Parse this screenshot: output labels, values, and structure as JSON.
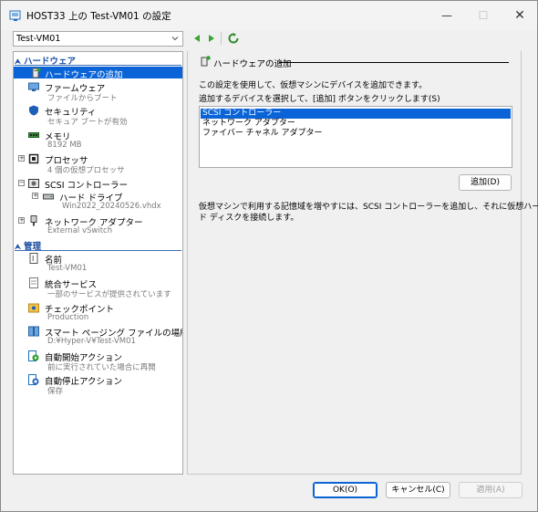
{
  "window": {
    "title": "HOST33 上の Test-VM01 の設定",
    "minimize": "—",
    "maximize": "☐",
    "close": "✕"
  },
  "vm_selector": {
    "value": "Test-VM01"
  },
  "sections": {
    "hardware": "ハードウェア",
    "management": "管理"
  },
  "hardware_items": [
    {
      "name": "add-hardware",
      "label": "ハードウェアの追加",
      "sub": ""
    },
    {
      "name": "firmware",
      "label": "ファームウェア",
      "sub": "ファイルからブート"
    },
    {
      "name": "security",
      "label": "セキュリティ",
      "sub": "セキュア ブートが有効"
    },
    {
      "name": "memory",
      "label": "メモリ",
      "sub": "8192 MB"
    },
    {
      "name": "processor",
      "label": "プロセッサ",
      "sub": "4 個の仮想プロセッサ"
    },
    {
      "name": "scsi-controller",
      "label": "SCSI コントローラー",
      "sub": ""
    },
    {
      "name": "hard-drive",
      "label": "ハード ドライブ",
      "sub": "Win2022_20240526.vhdx"
    },
    {
      "name": "network-adapter",
      "label": "ネットワーク アダプター",
      "sub": "External vSwitch"
    }
  ],
  "management_items": [
    {
      "name": "name",
      "label": "名前",
      "sub": "Test-VM01"
    },
    {
      "name": "integration-services",
      "label": "統合サービス",
      "sub": "一部のサービスが提供されています"
    },
    {
      "name": "checkpoints",
      "label": "チェックポイント",
      "sub": "Production"
    },
    {
      "name": "smart-paging",
      "label": "スマート ページング ファイルの場所",
      "sub": "D:¥Hyper-V¥Test-VM01"
    },
    {
      "name": "auto-start",
      "label": "自動開始アクション",
      "sub": "前に実行されていた場合に再開"
    },
    {
      "name": "auto-stop",
      "label": "自動停止アクション",
      "sub": "保存"
    }
  ],
  "right": {
    "header": "ハードウェアの追加",
    "desc1": "この設定を使用して、仮想マシンにデバイスを追加できます。",
    "desc2": "追加するデバイスを選択して、[追加] ボタンをクリックします(S)",
    "devices": [
      "SCSI コントローラー",
      "ネットワーク アダプター",
      "ファイバー チャネル アダプター"
    ],
    "add_button": "追加(D)",
    "info_line1": "仮想マシンで利用する記憶域を増やすには、SCSI コントローラーを追加し、それに仮想ハー",
    "info_line2": "ド ディスクを接続します。"
  },
  "footer": {
    "ok": "OK(O)",
    "cancel": "キャンセル(C)",
    "apply": "適用(A)"
  },
  "colors": {
    "selection": "#0a64d8",
    "section_text": "#1a4fa0",
    "nav_green": "#3aa335"
  }
}
